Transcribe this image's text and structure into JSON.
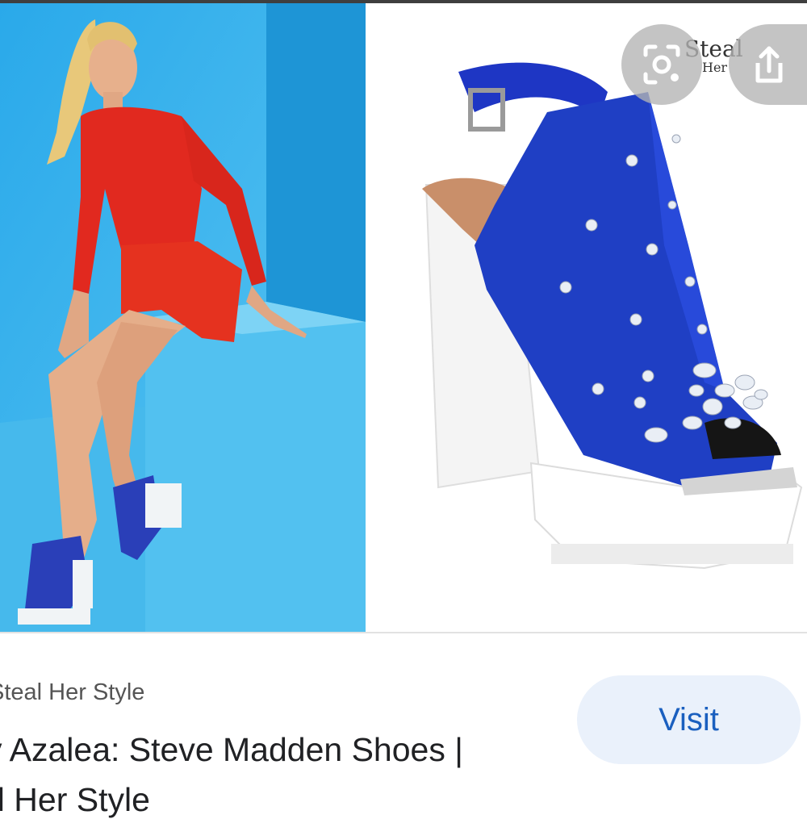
{
  "images": {
    "left_alt": "Iggy Azalea wearing red outfit and blue Steve Madden platform shoes",
    "right_alt": "Blue satin embellished Steve Madden platform heel"
  },
  "overlay": {
    "lens_icon": "google-lens-icon",
    "share_icon": "share-icon",
    "logo_line1": "Steal",
    "logo_line2": "Her"
  },
  "result": {
    "source": "Steal Her Style",
    "title_line1": "y Azalea: Steve Madden Shoes |",
    "title_line2": "al Her Style",
    "visit_label": "Visit"
  },
  "colors": {
    "accent": "#1a5fbf",
    "visit_bg": "#eaf1fb",
    "backdrop_blue": "#3fb6ee",
    "shoe_blue": "#1f3fc4",
    "outfit_red": "#e62b1f"
  }
}
